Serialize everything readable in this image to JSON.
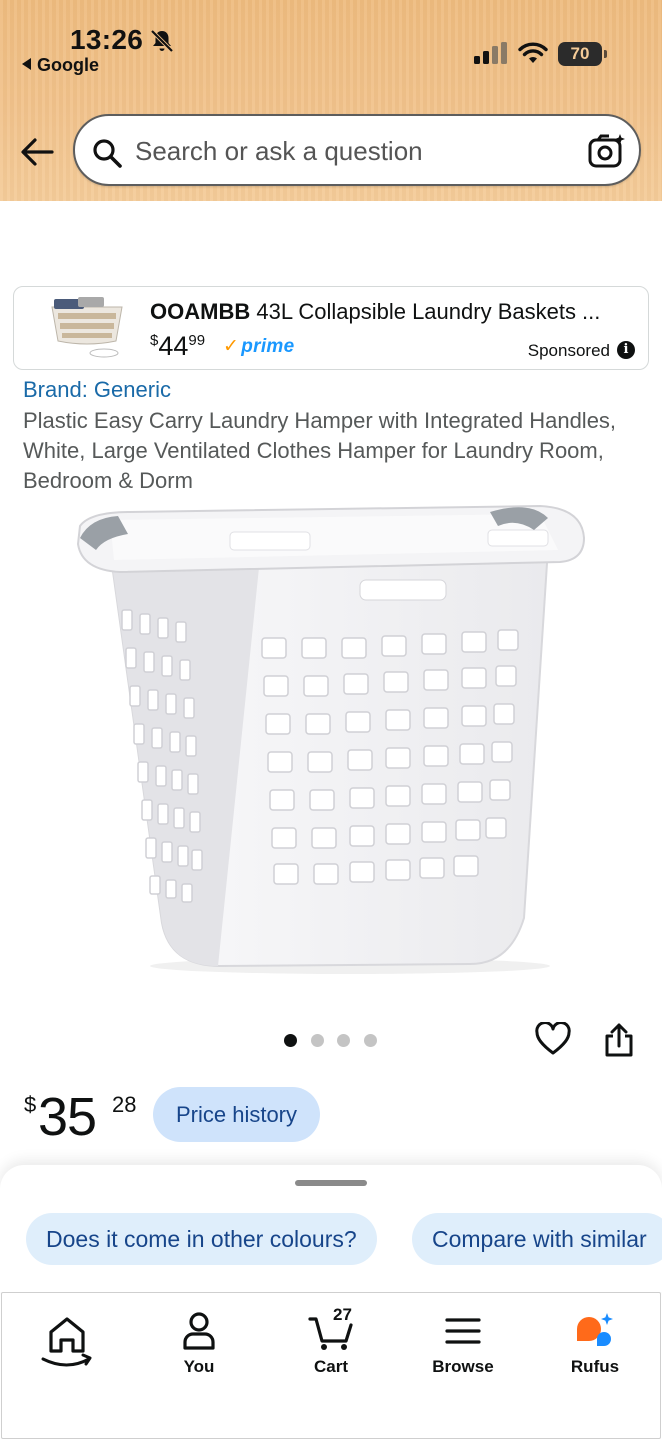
{
  "status_bar": {
    "time": "13:26",
    "back_app": "Google",
    "battery": "70"
  },
  "search": {
    "placeholder": "Search or ask a question"
  },
  "sponsored_ad": {
    "brand": "OOAMBB",
    "title": "43L Collapsible Laundry Baskets ...",
    "price_currency": "$",
    "price_whole": "44",
    "price_fraction": "99",
    "prime_label": "prime",
    "sponsored_label": "Sponsored"
  },
  "product": {
    "brand_line": "Brand: Generic",
    "title": "Plastic Easy Carry Laundry Hamper with Integrated Handles, White, Large Ventilated Clothes Hamper for Laundry Room, Bedroom & Dorm",
    "image_icon": "laundry-hamper-image",
    "image_count": 4,
    "active_image": 1,
    "price_currency": "$",
    "price_whole": "35",
    "price_fraction": "28",
    "price_history_label": "Price history"
  },
  "rufus_suggestions": [
    {
      "label": "Does it come in other colours?"
    },
    {
      "label": "Compare with similar"
    }
  ],
  "tabbar": {
    "items": [
      {
        "label": "",
        "icon": "home-icon"
      },
      {
        "label": "You",
        "icon": "person-icon"
      },
      {
        "label": "Cart",
        "icon": "cart-icon",
        "count": "27"
      },
      {
        "label": "Browse",
        "icon": "menu-icon"
      },
      {
        "label": "Rufus",
        "icon": "rufus-icon"
      }
    ]
  },
  "colors": {
    "header_bg": "#f1c28b",
    "link_blue": "#1a6aa8",
    "chip_bg": "#dfeefb",
    "price_history_bg": "#cfe3fb",
    "prime_blue": "#1a98ff",
    "prime_check": "#ff9900",
    "rufus_orange": "#ff6a1a"
  }
}
